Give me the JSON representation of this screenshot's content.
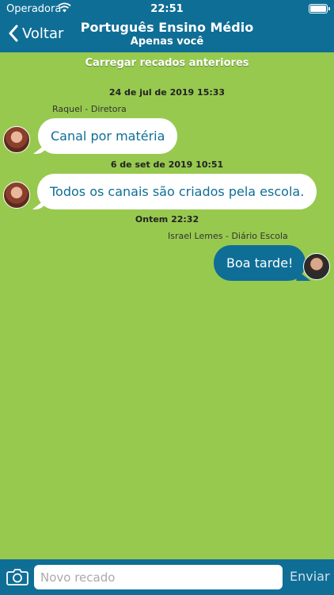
{
  "status": {
    "carrier": "Operadora",
    "time": "22:51"
  },
  "nav": {
    "back_label": "Voltar",
    "title": "Português Ensino Médio",
    "subtitle": "Apenas você"
  },
  "load_older": "Carregar recados anteriores",
  "messages": [
    {
      "stamp": "24 de jul de 2019 15:33",
      "sender": "Raquel  - Diretora",
      "text": "Canal por matéria",
      "direction": "in"
    },
    {
      "stamp": "6 de set de 2019 10:51",
      "sender": "",
      "text": "Todos os canais são criados pela escola.",
      "direction": "in"
    },
    {
      "stamp": "Ontem 22:32",
      "sender": "Israel Lemes - Diário Escola",
      "text": "Boa tarde!",
      "direction": "out"
    }
  ],
  "composer": {
    "placeholder": "Novo recado",
    "send_label": "Enviar"
  },
  "colors": {
    "header": "#0f6e96",
    "background": "#97c94f",
    "incoming_bubble": "#ffffff",
    "outgoing_bubble": "#0f6e96"
  },
  "icons": {
    "back": "chevron-left-icon",
    "camera": "camera-icon",
    "wifi": "wifi-icon",
    "battery": "battery-icon"
  }
}
